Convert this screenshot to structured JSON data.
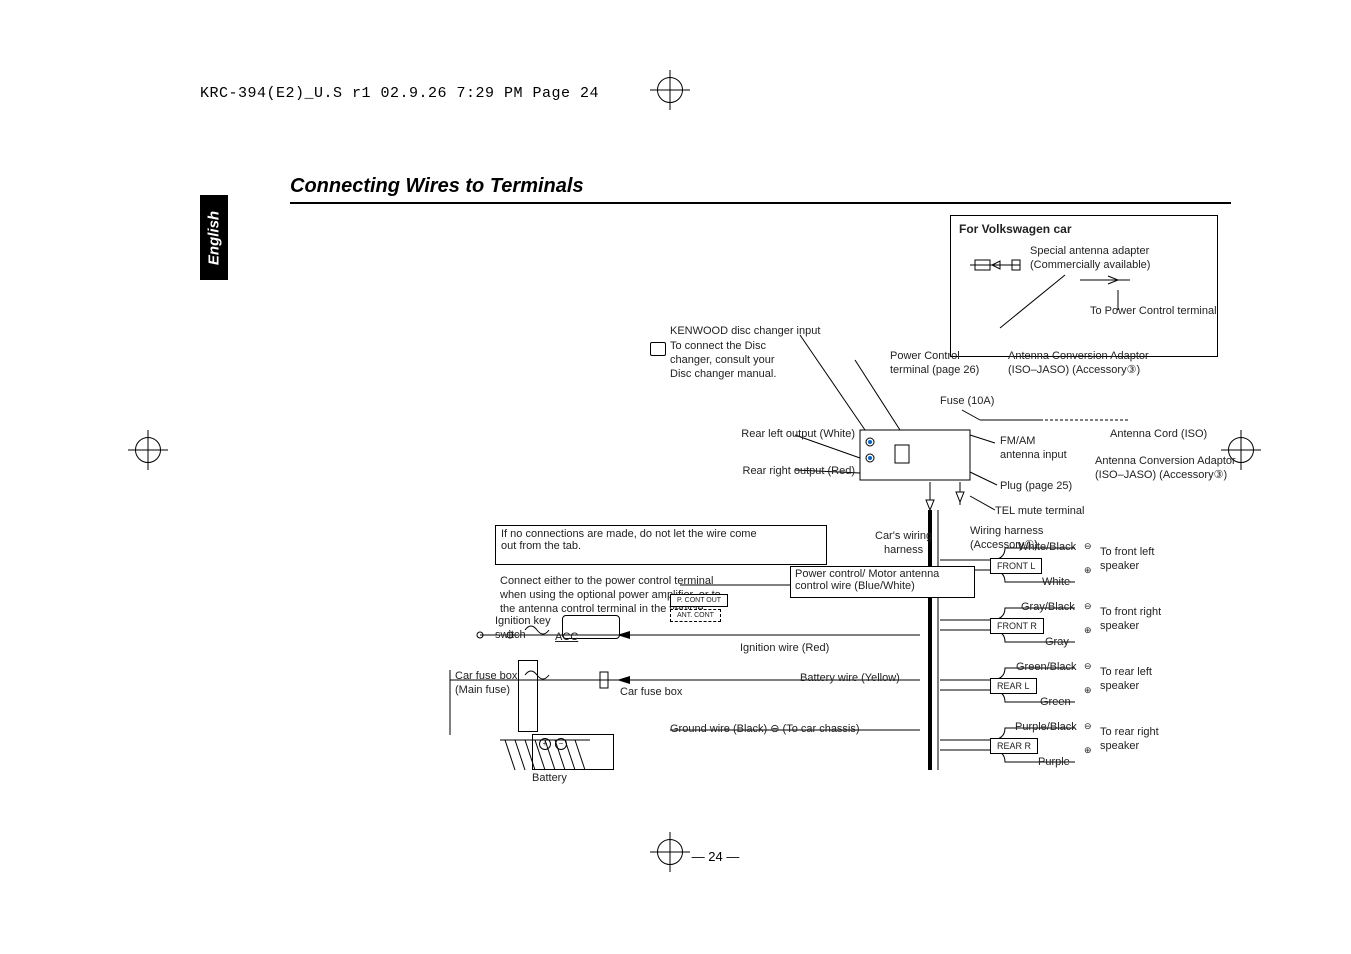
{
  "meta": {
    "file_line": "KRC-394(E2)_U.S r1  02.9.26  7:29 PM  Page 24"
  },
  "title": "Connecting Wires to Terminals",
  "language_tab": "English",
  "page_number": "— 24 —",
  "diagram": {
    "vw": {
      "head": "For Volkswagen car",
      "antenna_adapter": "Special antenna adapter\n(Commercially available)",
      "to_power": "To Power Control terminal",
      "conv_adaptor": "Antenna Conversion Adaptor\n(ISO–JASO) (Accessory③)"
    },
    "changer": {
      "title": "KENWOOD disc changer input",
      "note": "To connect the Disc\nchanger, consult your\nDisc changer manual."
    },
    "power_control": "Power Control\nterminal (page 26)",
    "fuse": "Fuse (10A)",
    "rear_left": "Rear left output (White)",
    "rear_right": "Rear right output (Red)",
    "fmam": "FM/AM\nantenna input",
    "ant_cord": "Antenna Cord (ISO)",
    "conv_adaptor2": "Antenna Conversion Adaptor\n(ISO–JASO) (Accessory③)",
    "plug": "Plug (page 25)",
    "tel_mute": "TEL mute terminal",
    "harness": "Wiring harness\n(Accessory①)",
    "cars_harness": "Car's wiring\nharness",
    "no_conn": "If no connections are made, do not let the wire come\nout from the tab.",
    "pwr_motor": "Power control/ Motor antenna\ncontrol wire (Blue/White)",
    "connect_either": "Connect either to the power control terminal\nwhen using the optional power amplifier, or to\nthe antenna control terminal in the vehicle.",
    "p_cont": "P. CONT OUT",
    "ant_cont": "ANT. CONT",
    "ign_switch": "Ignition key\nswitch",
    "acc": "ACC",
    "ignition_wire": "Ignition wire (Red)",
    "battery_wire": "Battery wire (Yellow)",
    "car_fuse_main": "Car fuse box\n(Main fuse)",
    "car_fuse": "Car fuse box",
    "ground": "Ground wire (Black) ⊖ (To car chassis)",
    "battery": "Battery",
    "spk": {
      "fl_neg": "White/Black",
      "fl_pos": "White",
      "fl_box": "FRONT L",
      "fl_to": "To front left\nspeaker",
      "fr_neg": "Gray/Black",
      "fr_pos": "Gray",
      "fr_box": "FRONT R",
      "fr_to": "To front right\nspeaker",
      "rl_neg": "Green/Black",
      "rl_pos": "Green",
      "rl_box": "REAR L",
      "rl_to": "To rear left\nspeaker",
      "rr_neg": "Purple/Black",
      "rr_pos": "Purple",
      "rr_box": "REAR R",
      "rr_to": "To rear right\nspeaker"
    }
  }
}
